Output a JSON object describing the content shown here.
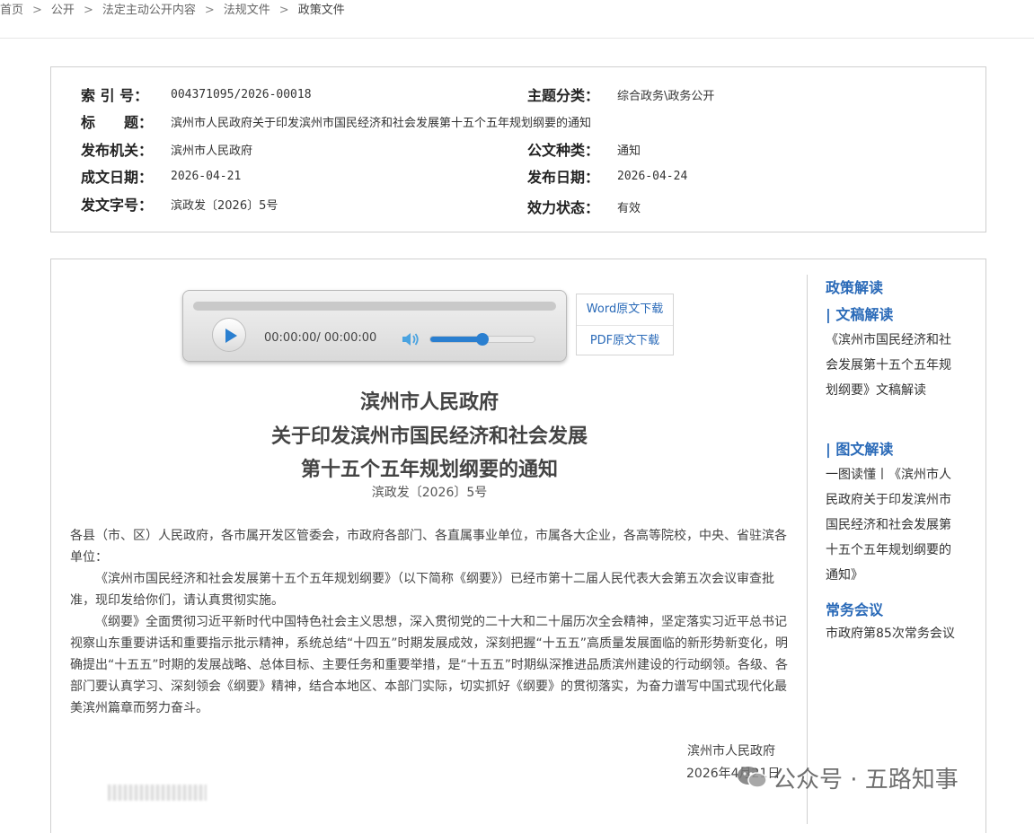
{
  "breadcrumb": {
    "items": [
      "首页",
      "公开",
      "法定主动公开内容",
      "法规文件"
    ],
    "current": "政策文件",
    "separator": ">"
  },
  "meta": {
    "index_label": "索 引 号：",
    "index_value": "004371095/2026-00018",
    "category_label": "主题分类：",
    "category_value": "综合政务\\政务公开",
    "title_label": "标　　题：",
    "title_value": "滨州市人民政府关于印发滨州市国民经济和社会发展第十五个五年规划纲要的通知",
    "issuer_label": "发布机关：",
    "issuer_value": "滨州市人民政府",
    "doctype_label": "公文种类：",
    "doctype_value": "通知",
    "written_label": "成文日期：",
    "written_value": "2026-04-21",
    "published_label": "发布日期：",
    "published_value": "2026-04-24",
    "docno_label": "发文字号：",
    "docno_value": "滨政发〔2026〕5号",
    "status_label": "效力状态：",
    "status_value": "有效"
  },
  "player": {
    "time": "00:00:00/ 00:00:00",
    "volume_fraction": 0.5,
    "accent": "#2a7fd0"
  },
  "downloads": {
    "word": "Word原文下载",
    "pdf": "PDF原文下载"
  },
  "document": {
    "title_lines": [
      "滨州市人民政府",
      "关于印发滨州市国民经济和社会发展",
      "第十五个五年规划纲要的通知"
    ],
    "doc_number": "滨政发〔2026〕5号",
    "recipients": "各县（市、区）人民政府，各市属开发区管委会，市政府各部门、各直属事业单位，市属各大企业，各高等院校，中央、省驻滨各单位：",
    "para1": "《滨州市国民经济和社会发展第十五个五年规划纲要》（以下简称《纲要》）已经市第十二届人民代表大会第五次会议审查批准，现印发给你们，请认真贯彻实施。",
    "para2": "《纲要》全面贯彻习近平新时代中国特色社会主义思想，深入贯彻党的二十大和二十届历次全会精神，坚定落实习近平总书记视察山东重要讲话和重要指示批示精神，系统总结“十四五”时期发展成效，深刻把握“十五五”高质量发展面临的新形势新变化，明确提出“十五五”时期的发展战略、总体目标、主要任务和重要举措，是“十五五”时期纵深推进品质滨州建设的行动纲领。各级、各部门要认真学习、深刻领会《纲要》精神，结合本地区、本部门实际，切实抓好《纲要》的贯彻落实，为奋力谱写中国式现代化最美滨州篇章而努力奋斗。",
    "sign_org": "滨州市人民政府",
    "sign_date": "2026年4月21日"
  },
  "sidebar": {
    "heading": "政策解读",
    "sub1": "| 文稿解读",
    "link1": "《滨州市国民经济和社会发展第十五个五年规划纲要》文稿解读",
    "sub2": "| 图文解读",
    "link2": "一图读懂丨《滨州市人民政府关于印发滨州市国民经济和社会发展第十五个五年规划纲要的通知》",
    "heading2": "常务会议",
    "link3": "市政府第85次常务会议"
  },
  "watermark": {
    "text": "公众号 · 五路知事"
  },
  "colors": {
    "link_blue": "#2a6ab8",
    "border": "#cfcfcf"
  }
}
